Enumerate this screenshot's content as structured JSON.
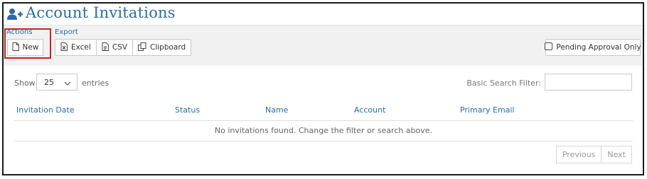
{
  "page": {
    "title": "Account Invitations",
    "icon": "user-plus-icon"
  },
  "toolbar": {
    "actions_label": "Actions",
    "export_label": "Export",
    "new_label": "New",
    "excel_label": "Excel",
    "csv_label": "CSV",
    "clipboard_label": "Clipboard",
    "pending_label": "Pending Approval Only",
    "pending_checked": false
  },
  "table_controls": {
    "show_label": "Show",
    "page_size": "25",
    "entries_label": "entries",
    "search_label": "Basic Search Filter:",
    "search_value": ""
  },
  "table": {
    "columns": [
      "Invitation Date",
      "Status",
      "Name",
      "Account",
      "Primary Email"
    ],
    "rows": [],
    "empty_message": "No invitations found. Change the filter or search above."
  },
  "pagination": {
    "previous_label": "Previous",
    "next_label": "Next"
  },
  "colors": {
    "accent": "#2d6ca2",
    "highlight": "#cc2222",
    "toolbar_bg": "#f1f1f1"
  }
}
